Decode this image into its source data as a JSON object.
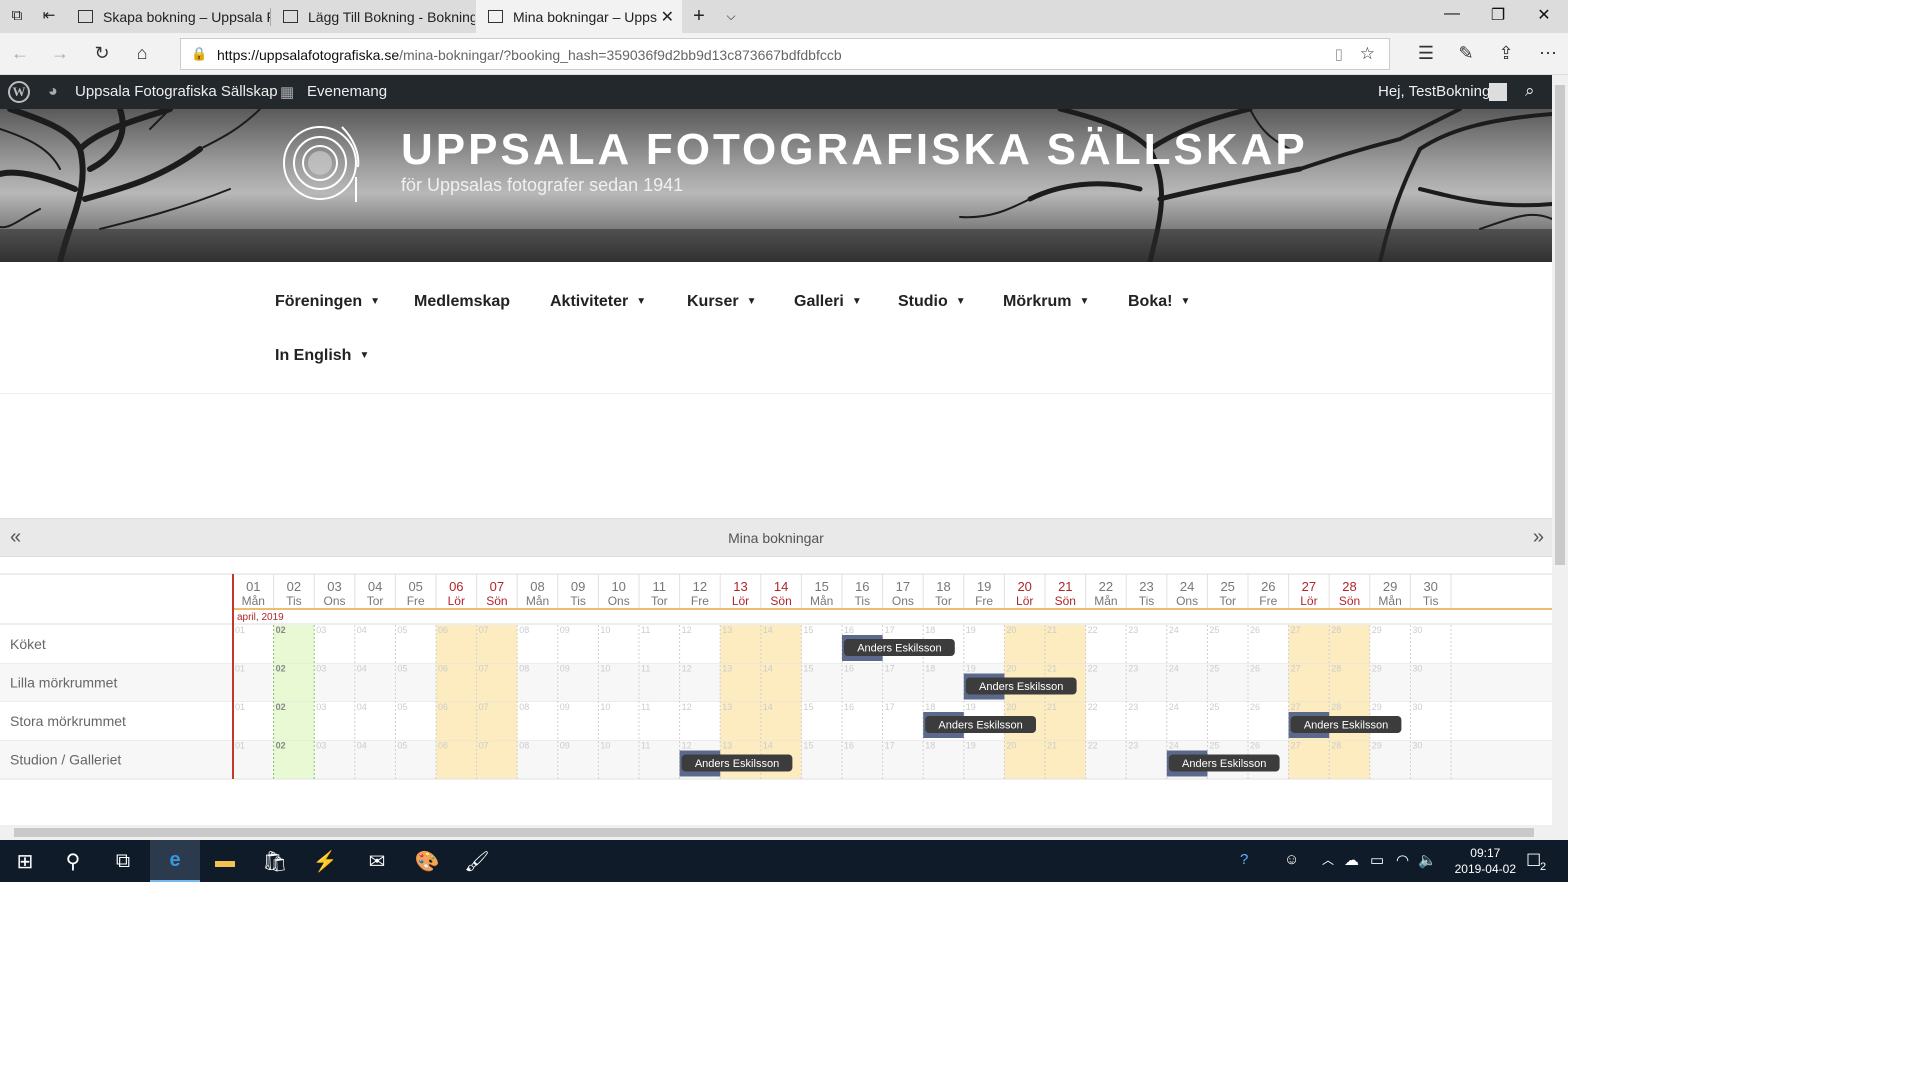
{
  "browser": {
    "tabs": [
      {
        "label": "Skapa bokning – Uppsala Fo",
        "active": false
      },
      {
        "label": "Lägg Till Bokning - Bokning",
        "active": false
      },
      {
        "label": "Mina bokningar – Upps",
        "active": true
      }
    ],
    "url_host": "https://uppsalafotografiska.se",
    "url_path": "/mina-bokningar/?booking_hash=359036f9d2bb9d13c873667bdfdbfccb"
  },
  "wpbar": {
    "site_name": "Uppsala Fotografiska Sällskap",
    "events_label": "Evenemang",
    "greeting": "Hej, TestBokning"
  },
  "site": {
    "title": "UPPSALA FOTOGRAFISKA SÄLLSKAP",
    "description": "för Uppsalas fotografer sedan 1941"
  },
  "nav": {
    "items": [
      {
        "label": "Föreningen",
        "dropdown": true
      },
      {
        "label": "Medlemskap",
        "dropdown": false
      },
      {
        "label": "Aktiviteter",
        "dropdown": true
      },
      {
        "label": "Kurser",
        "dropdown": true
      },
      {
        "label": "Galleri",
        "dropdown": true
      },
      {
        "label": "Studio",
        "dropdown": true
      },
      {
        "label": "Mörkrum",
        "dropdown": true
      },
      {
        "label": "Boka!",
        "dropdown": true
      },
      {
        "label": "In English",
        "dropdown": true
      }
    ]
  },
  "calendar": {
    "prev": "«",
    "next": "»",
    "title": "Mina bokningar",
    "month_label": "april, 2019",
    "today": "02",
    "days": [
      {
        "num": "01",
        "wd": "Mån"
      },
      {
        "num": "02",
        "wd": "Tis"
      },
      {
        "num": "03",
        "wd": "Ons"
      },
      {
        "num": "04",
        "wd": "Tor"
      },
      {
        "num": "05",
        "wd": "Fre"
      },
      {
        "num": "06",
        "wd": "Lör"
      },
      {
        "num": "07",
        "wd": "Sön"
      },
      {
        "num": "08",
        "wd": "Mån"
      },
      {
        "num": "09",
        "wd": "Tis"
      },
      {
        "num": "10",
        "wd": "Ons"
      },
      {
        "num": "11",
        "wd": "Tor"
      },
      {
        "num": "12",
        "wd": "Fre"
      },
      {
        "num": "13",
        "wd": "Lör"
      },
      {
        "num": "14",
        "wd": "Sön"
      },
      {
        "num": "15",
        "wd": "Mån"
      },
      {
        "num": "16",
        "wd": "Tis"
      },
      {
        "num": "17",
        "wd": "Ons"
      },
      {
        "num": "18",
        "wd": "Tor"
      },
      {
        "num": "19",
        "wd": "Fre"
      },
      {
        "num": "20",
        "wd": "Lör"
      },
      {
        "num": "21",
        "wd": "Sön"
      },
      {
        "num": "22",
        "wd": "Mån"
      },
      {
        "num": "23",
        "wd": "Tis"
      },
      {
        "num": "24",
        "wd": "Ons"
      },
      {
        "num": "25",
        "wd": "Tor"
      },
      {
        "num": "26",
        "wd": "Fre"
      },
      {
        "num": "27",
        "wd": "Lör"
      },
      {
        "num": "28",
        "wd": "Sön"
      },
      {
        "num": "29",
        "wd": "Mån"
      },
      {
        "num": "30",
        "wd": "Tis"
      }
    ],
    "rooms": [
      "Köket",
      "Lilla mörkrummet",
      "Stora mörkrummet",
      "Studion / Galleriet"
    ],
    "bookings": [
      {
        "room": 0,
        "day": "16",
        "name": "Anders Eskilsson"
      },
      {
        "room": 1,
        "day": "19",
        "name": "Anders Eskilsson"
      },
      {
        "room": 2,
        "day": "18",
        "name": "Anders Eskilsson"
      },
      {
        "room": 2,
        "day": "27",
        "name": "Anders Eskilsson"
      },
      {
        "room": 3,
        "day": "12",
        "name": "Anders Eskilsson"
      },
      {
        "room": 3,
        "day": "24",
        "name": "Anders Eskilsson"
      }
    ],
    "colors": {
      "weekend_bg": "#fcecc0",
      "today_bg": "#e8f9d4",
      "weekend_text": "#b0262b",
      "booking_bg": "#3c3c3c",
      "booking_bar": "#5b6a8c"
    }
  },
  "taskbar": {
    "time": "09:17",
    "date": "2019-04-02",
    "notification_count": "2"
  }
}
